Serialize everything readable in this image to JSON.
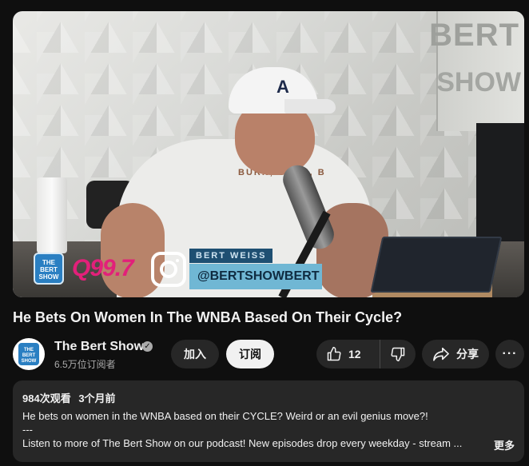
{
  "video": {
    "overlay": {
      "station_logo": "Q99.7",
      "bert_logo_text": "THE BERT SHOW",
      "handle_label": "BERT WEISS",
      "handle": "@BERTSHOWBERT",
      "shirt_text": "BURN, BURN, B",
      "wall_sign_1": "BERT",
      "wall_sign_2": "SHOW",
      "cap_logo": "A"
    }
  },
  "title": "He Bets On Women In The WNBA Based On Their Cycle?",
  "channel": {
    "name": "The Bert Show",
    "subscribers": "6.5万位订阅者",
    "avatar_text": "THE BERT SHOW"
  },
  "actions": {
    "join_label": "加入",
    "subscribe_label": "订阅",
    "like_count": "12",
    "share_label": "分享",
    "more_label": "···"
  },
  "description": {
    "views": "984次观看",
    "date": "3个月前",
    "line1": "He bets on women in the WNBA based on their CYCLE? Weird or an evil genius move?!",
    "line2": "---",
    "line3": "Listen to more of The Bert Show on our podcast! New episodes drop every weekday - stream ...",
    "more_link": "更多"
  },
  "colors": {
    "background": "#0f0f0f",
    "pill": "#272727",
    "subscribe_bg": "#f1f1f1",
    "text_secondary": "#aaaaaa"
  },
  "icons": {
    "like": "thumbs-up-icon",
    "dislike": "thumbs-down-icon",
    "share": "share-arrow-icon",
    "verified": "verified-check-icon",
    "more": "more-horizontal-icon"
  }
}
